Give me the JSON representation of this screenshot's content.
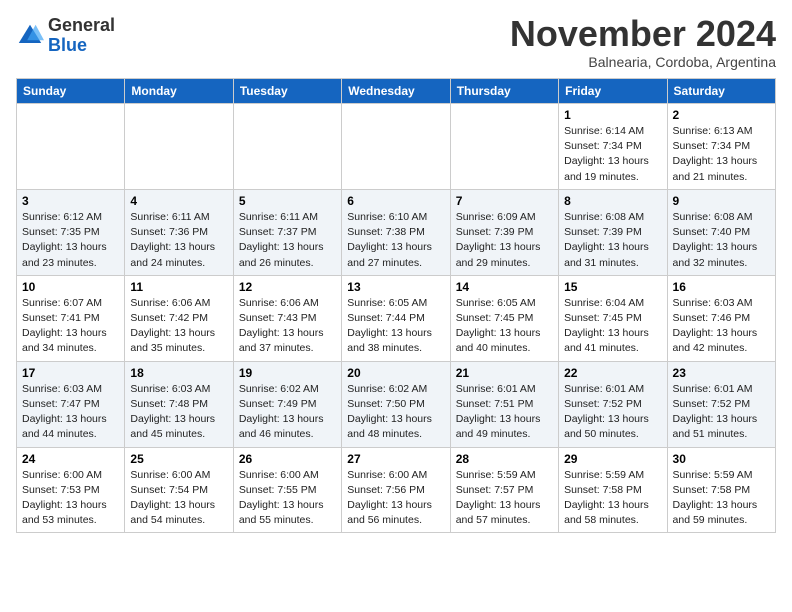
{
  "header": {
    "logo_general": "General",
    "logo_blue": "Blue",
    "month_title": "November 2024",
    "location": "Balnearia, Cordoba, Argentina"
  },
  "weekdays": [
    "Sunday",
    "Monday",
    "Tuesday",
    "Wednesday",
    "Thursday",
    "Friday",
    "Saturday"
  ],
  "weeks": [
    [
      {
        "day": "",
        "info": ""
      },
      {
        "day": "",
        "info": ""
      },
      {
        "day": "",
        "info": ""
      },
      {
        "day": "",
        "info": ""
      },
      {
        "day": "",
        "info": ""
      },
      {
        "day": "1",
        "info": "Sunrise: 6:14 AM\nSunset: 7:34 PM\nDaylight: 13 hours\nand 19 minutes."
      },
      {
        "day": "2",
        "info": "Sunrise: 6:13 AM\nSunset: 7:34 PM\nDaylight: 13 hours\nand 21 minutes."
      }
    ],
    [
      {
        "day": "3",
        "info": "Sunrise: 6:12 AM\nSunset: 7:35 PM\nDaylight: 13 hours\nand 23 minutes."
      },
      {
        "day": "4",
        "info": "Sunrise: 6:11 AM\nSunset: 7:36 PM\nDaylight: 13 hours\nand 24 minutes."
      },
      {
        "day": "5",
        "info": "Sunrise: 6:11 AM\nSunset: 7:37 PM\nDaylight: 13 hours\nand 26 minutes."
      },
      {
        "day": "6",
        "info": "Sunrise: 6:10 AM\nSunset: 7:38 PM\nDaylight: 13 hours\nand 27 minutes."
      },
      {
        "day": "7",
        "info": "Sunrise: 6:09 AM\nSunset: 7:39 PM\nDaylight: 13 hours\nand 29 minutes."
      },
      {
        "day": "8",
        "info": "Sunrise: 6:08 AM\nSunset: 7:39 PM\nDaylight: 13 hours\nand 31 minutes."
      },
      {
        "day": "9",
        "info": "Sunrise: 6:08 AM\nSunset: 7:40 PM\nDaylight: 13 hours\nand 32 minutes."
      }
    ],
    [
      {
        "day": "10",
        "info": "Sunrise: 6:07 AM\nSunset: 7:41 PM\nDaylight: 13 hours\nand 34 minutes."
      },
      {
        "day": "11",
        "info": "Sunrise: 6:06 AM\nSunset: 7:42 PM\nDaylight: 13 hours\nand 35 minutes."
      },
      {
        "day": "12",
        "info": "Sunrise: 6:06 AM\nSunset: 7:43 PM\nDaylight: 13 hours\nand 37 minutes."
      },
      {
        "day": "13",
        "info": "Sunrise: 6:05 AM\nSunset: 7:44 PM\nDaylight: 13 hours\nand 38 minutes."
      },
      {
        "day": "14",
        "info": "Sunrise: 6:05 AM\nSunset: 7:45 PM\nDaylight: 13 hours\nand 40 minutes."
      },
      {
        "day": "15",
        "info": "Sunrise: 6:04 AM\nSunset: 7:45 PM\nDaylight: 13 hours\nand 41 minutes."
      },
      {
        "day": "16",
        "info": "Sunrise: 6:03 AM\nSunset: 7:46 PM\nDaylight: 13 hours\nand 42 minutes."
      }
    ],
    [
      {
        "day": "17",
        "info": "Sunrise: 6:03 AM\nSunset: 7:47 PM\nDaylight: 13 hours\nand 44 minutes."
      },
      {
        "day": "18",
        "info": "Sunrise: 6:03 AM\nSunset: 7:48 PM\nDaylight: 13 hours\nand 45 minutes."
      },
      {
        "day": "19",
        "info": "Sunrise: 6:02 AM\nSunset: 7:49 PM\nDaylight: 13 hours\nand 46 minutes."
      },
      {
        "day": "20",
        "info": "Sunrise: 6:02 AM\nSunset: 7:50 PM\nDaylight: 13 hours\nand 48 minutes."
      },
      {
        "day": "21",
        "info": "Sunrise: 6:01 AM\nSunset: 7:51 PM\nDaylight: 13 hours\nand 49 minutes."
      },
      {
        "day": "22",
        "info": "Sunrise: 6:01 AM\nSunset: 7:52 PM\nDaylight: 13 hours\nand 50 minutes."
      },
      {
        "day": "23",
        "info": "Sunrise: 6:01 AM\nSunset: 7:52 PM\nDaylight: 13 hours\nand 51 minutes."
      }
    ],
    [
      {
        "day": "24",
        "info": "Sunrise: 6:00 AM\nSunset: 7:53 PM\nDaylight: 13 hours\nand 53 minutes."
      },
      {
        "day": "25",
        "info": "Sunrise: 6:00 AM\nSunset: 7:54 PM\nDaylight: 13 hours\nand 54 minutes."
      },
      {
        "day": "26",
        "info": "Sunrise: 6:00 AM\nSunset: 7:55 PM\nDaylight: 13 hours\nand 55 minutes."
      },
      {
        "day": "27",
        "info": "Sunrise: 6:00 AM\nSunset: 7:56 PM\nDaylight: 13 hours\nand 56 minutes."
      },
      {
        "day": "28",
        "info": "Sunrise: 5:59 AM\nSunset: 7:57 PM\nDaylight: 13 hours\nand 57 minutes."
      },
      {
        "day": "29",
        "info": "Sunrise: 5:59 AM\nSunset: 7:58 PM\nDaylight: 13 hours\nand 58 minutes."
      },
      {
        "day": "30",
        "info": "Sunrise: 5:59 AM\nSunset: 7:58 PM\nDaylight: 13 hours\nand 59 minutes."
      }
    ]
  ]
}
